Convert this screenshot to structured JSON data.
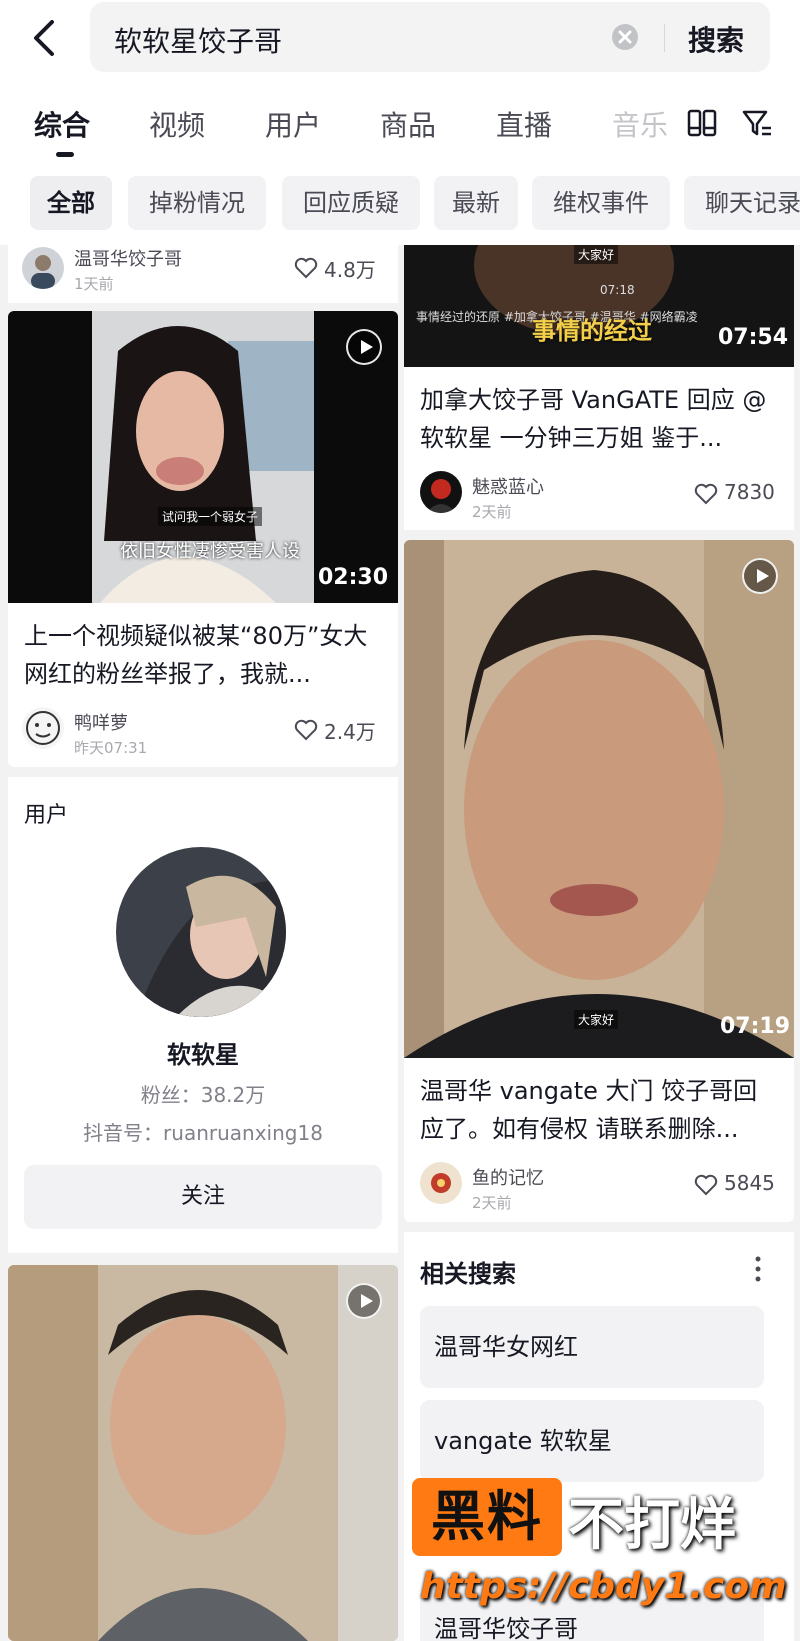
{
  "search": {
    "query": "软软星饺子哥",
    "button_label": "搜索"
  },
  "tabs": [
    "综合",
    "视频",
    "用户",
    "商品",
    "直播",
    "音乐"
  ],
  "chips": [
    "全部",
    "掉粉情况",
    "回应质疑",
    "最新",
    "维权事件",
    "聊天记录"
  ],
  "cards": {
    "top_left": {
      "user": "温哥华饺子哥",
      "time": "1天前",
      "likes": "4.8万"
    },
    "video1": {
      "duration": "02:30",
      "caption_lines": [
        "试问我一个弱女子",
        "依旧女性凄惨受害人设"
      ],
      "title": "上一个视频疑似被某“80万”女大网红的粉丝举报了，我就...",
      "user": "鸭咩萝",
      "time": "昨天07:31",
      "likes": "2.4万"
    },
    "top_right": {
      "duration": "07:54",
      "overlay_small": "大家好",
      "overlay_meta": "07:18",
      "overlay_tags": "事情经过的还原 #加拿大饺子哥 #温哥华 #网络霸凌",
      "overlay_caption": "事情的经过",
      "title": "加拿大饺子哥 VanGATE 回应 @软软星 一分钟三万姐 鉴于...",
      "user": "魅惑蓝心",
      "time": "2天前",
      "likes": "7830"
    },
    "video_right": {
      "duration": "07:19",
      "overlay_small": "大家好",
      "title": "温哥华 vangate 大门 饺子哥回应了。如有侵权 请联系删除...",
      "user": "鱼的记忆",
      "time": "2天前",
      "likes": "5845"
    }
  },
  "user_card": {
    "section_label": "用户",
    "name": "软软星",
    "fans": "粉丝：38.2万",
    "douyin_id": "抖音号：ruanruanxing18",
    "follow_label": "关注"
  },
  "related": {
    "title": "相关搜索",
    "items": [
      "温哥华女网红",
      "vangate 软软星",
      "温哥华饺子哥"
    ]
  },
  "watermark": {
    "box_text": "黑料",
    "text": "不打烊",
    "url": "https://cbdy1.com"
  },
  "colors": {
    "accent": "#ff7a12",
    "text": "#161823",
    "muted": "#a8a9ae",
    "bg": "#f2f2f3"
  }
}
